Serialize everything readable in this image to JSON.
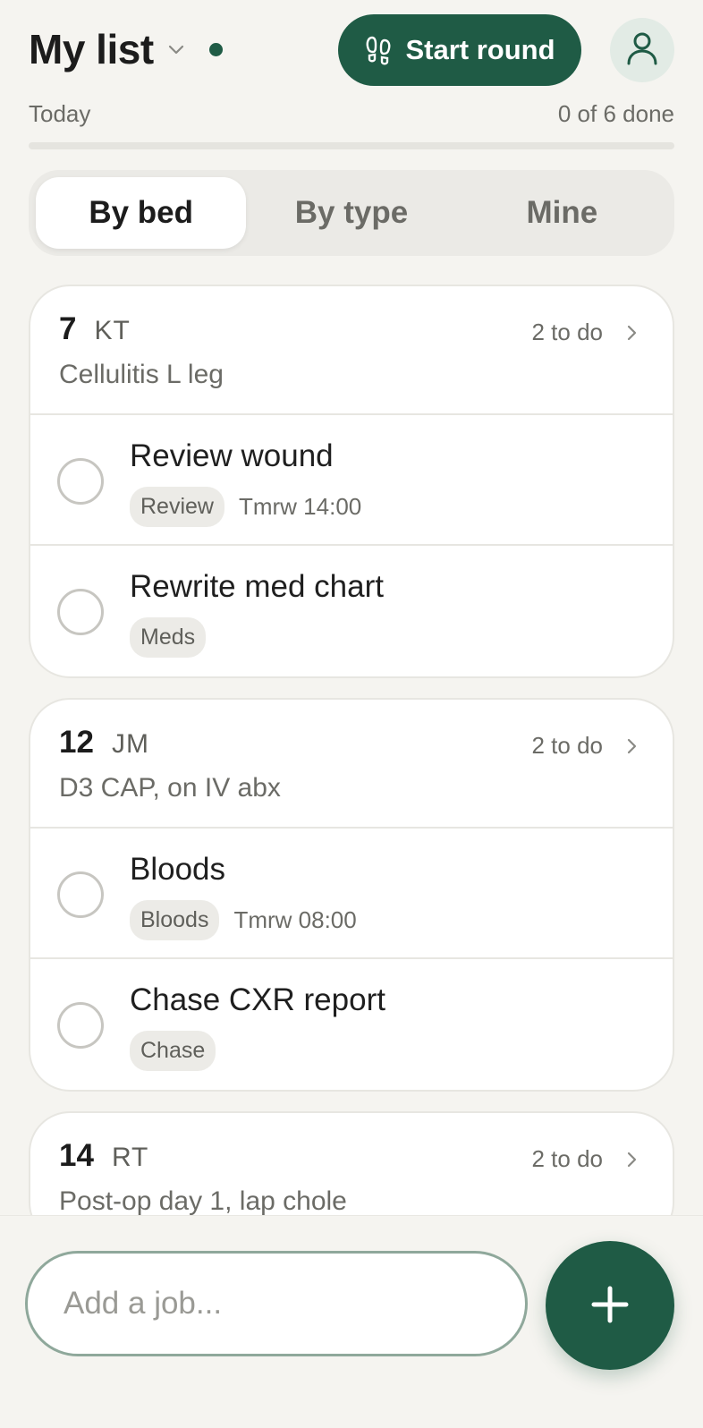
{
  "header": {
    "title": "My list",
    "start_round_label": "Start round",
    "date_label": "Today",
    "done_label": "0 of 6 done",
    "progress_fraction": 0,
    "accent_color": "#1f5b45"
  },
  "tabs": [
    {
      "label": "By bed",
      "active": true
    },
    {
      "label": "By type",
      "active": false
    },
    {
      "label": "Mine",
      "active": false
    }
  ],
  "beds": [
    {
      "bed": "7",
      "initials": "KT",
      "diagnosis": "Cellulitis L leg",
      "todo": "2 to do",
      "tasks": [
        {
          "title": "Review wound",
          "tag": "Review",
          "due": "Tmrw 14:00"
        },
        {
          "title": "Rewrite med chart",
          "tag": "Meds",
          "due": ""
        }
      ]
    },
    {
      "bed": "12",
      "initials": "JM",
      "diagnosis": "D3 CAP, on IV abx",
      "todo": "2 to do",
      "tasks": [
        {
          "title": "Bloods",
          "tag": "Bloods",
          "due": "Tmrw 08:00"
        },
        {
          "title": "Chase CXR report",
          "tag": "Chase",
          "due": ""
        }
      ]
    },
    {
      "bed": "14",
      "initials": "RT",
      "diagnosis": "Post-op day 1, lap chole",
      "todo": "2 to do",
      "tasks": []
    }
  ],
  "composer": {
    "placeholder": "Add a job...",
    "value": ""
  },
  "icons": {
    "title_chevron": "chevron-down-icon",
    "status": "status-dot",
    "round": "footsteps-icon",
    "profile": "user-icon",
    "bed_chevron": "chevron-right-icon",
    "add": "plus-icon"
  }
}
